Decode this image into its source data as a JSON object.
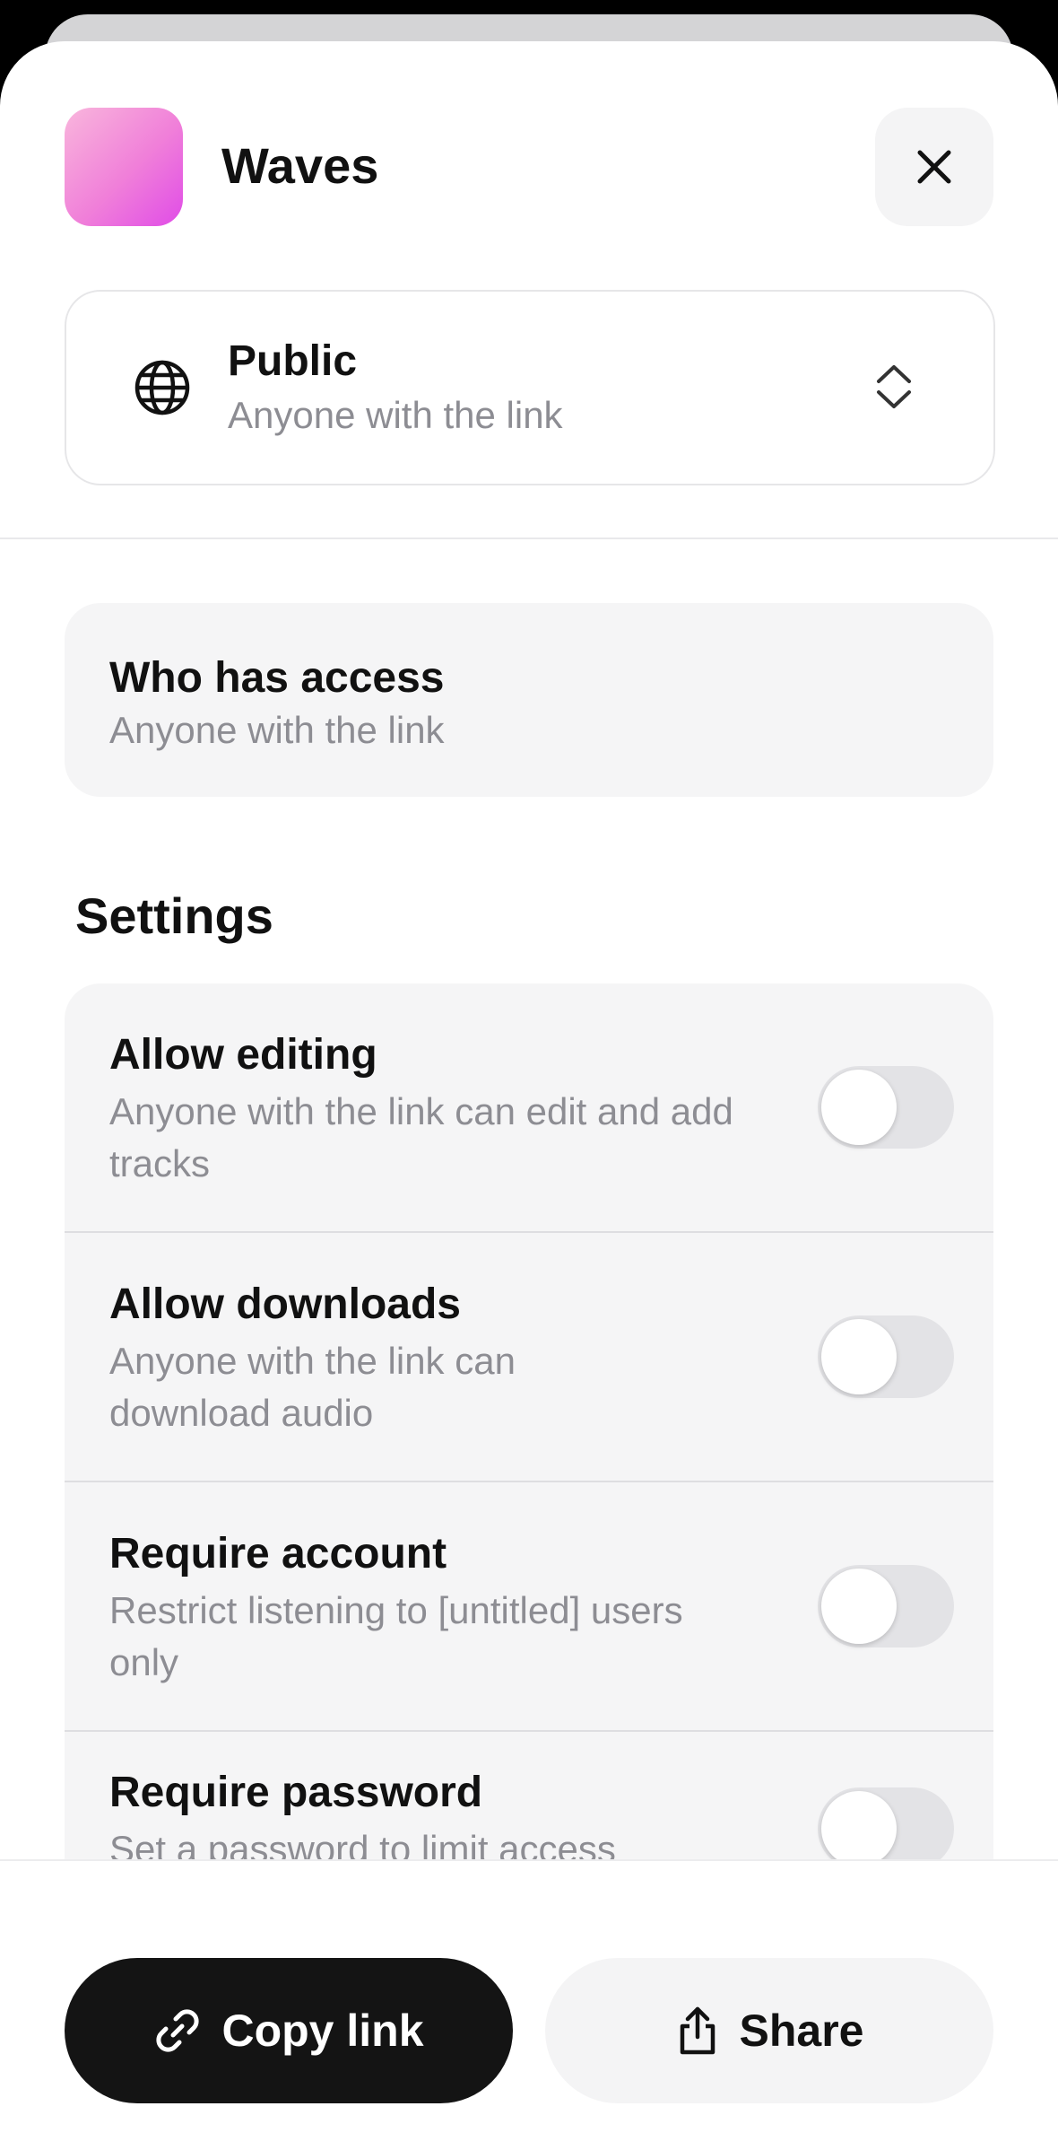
{
  "header": {
    "app_name": "Waves",
    "close_icon": "close-icon",
    "app_icon_gradient": [
      "#f9b6dc",
      "#e04ce7"
    ]
  },
  "visibility": {
    "title": "Public",
    "subtitle": "Anyone with the link",
    "icon": "globe-icon",
    "chevron": "chevron-up-down-icon"
  },
  "access": {
    "title": "Who has access",
    "subtitle": "Anyone with the link"
  },
  "settings": {
    "heading": "Settings",
    "items": [
      {
        "title": "Allow editing",
        "description": "Anyone with the link can edit and add tracks",
        "enabled": false
      },
      {
        "title": "Allow downloads",
        "description": "Anyone with the link can download audio",
        "enabled": false
      },
      {
        "title": "Require account",
        "description": "Restrict listening to [untitled] users only",
        "enabled": false
      },
      {
        "title": "Require password",
        "description": "Set a password to limit access",
        "enabled": false
      }
    ]
  },
  "actions": {
    "copy_label": "Copy link",
    "share_label": "Share",
    "copy_icon": "link-icon",
    "share_icon": "share-icon"
  },
  "colors": {
    "primary_button": "#141414",
    "card_background": "#f5f5f6",
    "muted_text": "#8d8d93"
  }
}
